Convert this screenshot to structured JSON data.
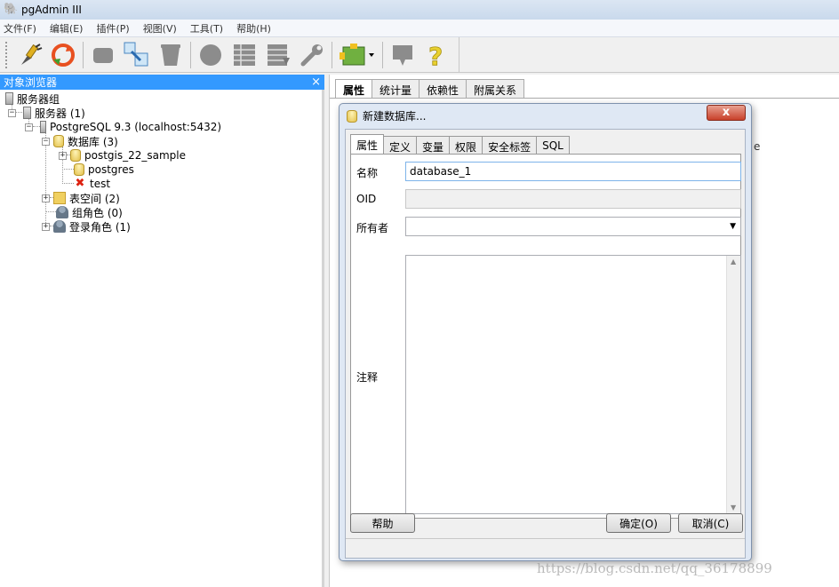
{
  "window": {
    "title": "pgAdmin III"
  },
  "menubar": {
    "items": [
      "文件(F)",
      "编辑(E)",
      "插件(P)",
      "视图(V)",
      "工具(T)",
      "帮助(H)"
    ]
  },
  "toolbar": {
    "icons": [
      "connect-icon",
      "refresh-icon",
      "properties-icon",
      "create-icon",
      "delete-icon",
      "sql-icon",
      "view-data-icon",
      "filtered-data-icon",
      "maintenance-icon",
      "plugins-icon",
      "hint-icon",
      "help-icon"
    ]
  },
  "browser": {
    "title": "对象浏览器",
    "close_label": "×",
    "tree": {
      "root": "服务器组",
      "servers": "服务器 (1)",
      "postgres_server": "PostgreSQL 9.3 (localhost:5432)",
      "databases": "数据库 (3)",
      "db1": "postgis_22_sample",
      "db2": "postgres",
      "db3": "test",
      "tablespaces": "表空间 (2)",
      "group_roles": "组角色 (0)",
      "login_roles": "登录角色 (1)"
    }
  },
  "right_panel": {
    "tabs": [
      "属性",
      "统计量",
      "依赖性",
      "附属关系"
    ],
    "fragment_e": "e"
  },
  "dialog": {
    "title": "新建数据库...",
    "close_label": "x",
    "tabs": [
      "属性",
      "定义",
      "变量",
      "权限",
      "安全标签",
      "SQL"
    ],
    "fields": {
      "name_label": "名称",
      "name_value": "database_1",
      "oid_label": "OID",
      "oid_value": "",
      "owner_label": "所有者",
      "owner_value": "",
      "comment_label": "注释",
      "comment_value": ""
    },
    "buttons": {
      "help": "帮助",
      "ok": "确定(O)",
      "cancel": "取消(C)"
    }
  },
  "watermark": "https://blog.csdn.net/qq_36178899"
}
